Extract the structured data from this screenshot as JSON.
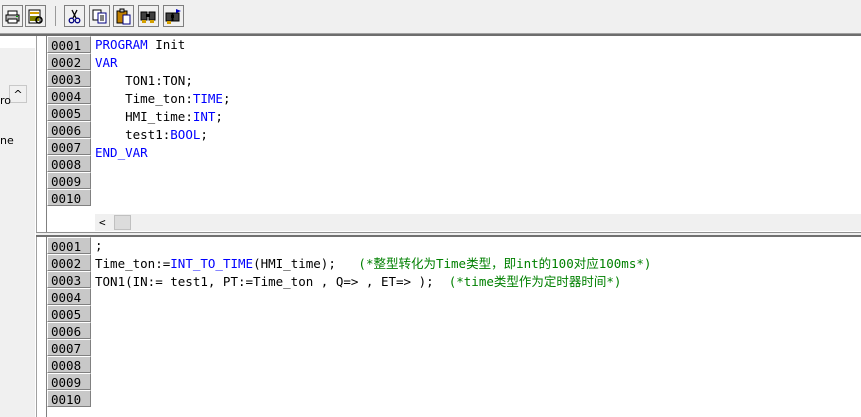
{
  "toolbar": {
    "buttons": [
      {
        "icon": "print-icon"
      },
      {
        "icon": "print-preview-icon"
      },
      {
        "icon": "cut-icon"
      },
      {
        "icon": "copy-icon"
      },
      {
        "icon": "paste-icon"
      },
      {
        "icon": "find-icon"
      },
      {
        "icon": "find-next-icon"
      }
    ]
  },
  "left_panel": {
    "fragment_1": "ro",
    "fragment_2": "ne",
    "scroll_up_glyph": "^"
  },
  "declaration_pane": {
    "line_numbers": [
      "0001",
      "0002",
      "0003",
      "0004",
      "0005",
      "0006",
      "0007",
      "0008",
      "0009",
      "0010"
    ],
    "lines": [
      {
        "indent": "",
        "parts": [
          {
            "t": "PROGRAM",
            "k": "kw"
          },
          {
            "t": " Init",
            "k": ""
          }
        ]
      },
      {
        "indent": "",
        "parts": [
          {
            "t": "VAR",
            "k": "kw"
          }
        ]
      },
      {
        "indent": "    ",
        "parts": [
          {
            "t": "TON1:TON;",
            "k": ""
          }
        ]
      },
      {
        "indent": "    ",
        "parts": [
          {
            "t": "Time_ton:",
            "k": ""
          },
          {
            "t": "TIME",
            "k": "kw"
          },
          {
            "t": ";",
            "k": ""
          }
        ]
      },
      {
        "indent": "    ",
        "parts": [
          {
            "t": "HMI_time:",
            "k": ""
          },
          {
            "t": "INT",
            "k": "kw"
          },
          {
            "t": ";",
            "k": ""
          }
        ]
      },
      {
        "indent": "    ",
        "parts": [
          {
            "t": "test1:",
            "k": ""
          },
          {
            "t": "BOOL",
            "k": "kw"
          },
          {
            "t": ";",
            "k": ""
          }
        ]
      },
      {
        "indent": "",
        "parts": [
          {
            "t": "END_VAR",
            "k": "kw"
          }
        ]
      }
    ],
    "hscroll_left_glyph": "<"
  },
  "body_pane": {
    "line_numbers": [
      "0001",
      "0002",
      "0003",
      "0004",
      "0005",
      "0006",
      "0007",
      "0008",
      "0009",
      "0010"
    ],
    "lines": [
      {
        "indent": "",
        "parts": [
          {
            "t": ";",
            "k": ""
          }
        ]
      },
      {
        "indent": "",
        "parts": [
          {
            "t": "Time_ton:=",
            "k": ""
          },
          {
            "t": "INT_TO_TIME",
            "k": "kw"
          },
          {
            "t": "(HMI_time);   ",
            "k": ""
          },
          {
            "t": "(*整型转化为Time类型，即int的100对应100ms*)",
            "k": "cm"
          }
        ]
      },
      {
        "indent": "",
        "parts": [
          {
            "t": "TON1(IN:= test1, PT:=Time_ton , Q=> , ET=> );  ",
            "k": ""
          },
          {
            "t": "(*time类型作为定时器时间*)",
            "k": "cm"
          }
        ]
      }
    ]
  }
}
